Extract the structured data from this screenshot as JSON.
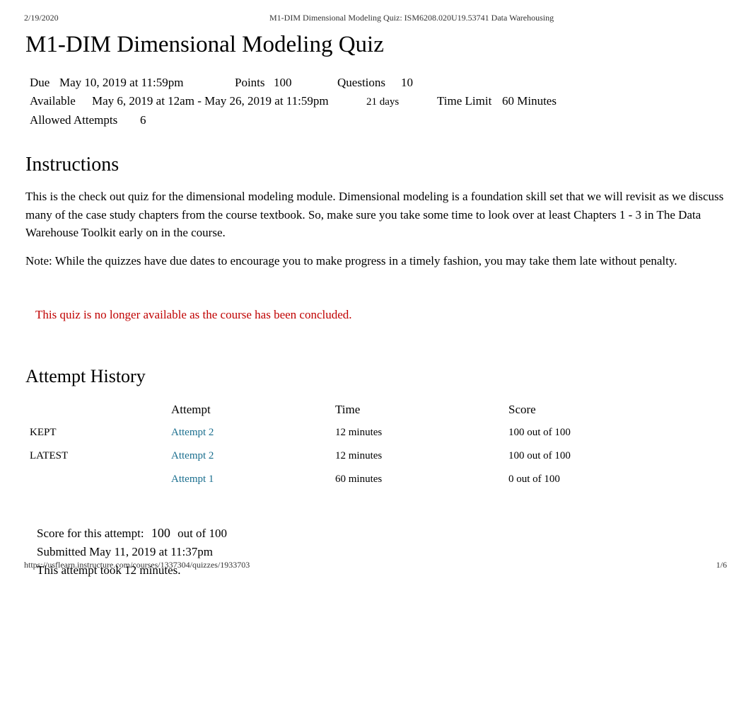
{
  "header": {
    "print_date": "2/19/2020",
    "doc_title": "M1-DIM Dimensional Modeling Quiz: ISM6208.020U19.53741 Data Warehousing"
  },
  "title": "M1-DIM Dimensional Modeling Quiz",
  "meta": {
    "due_label": "Due",
    "due_value": "May 10, 2019 at 11:59pm",
    "points_label": "Points",
    "points_value": "100",
    "questions_label": "Questions",
    "questions_value": "10",
    "available_label": "Available",
    "available_value": "May 6, 2019 at 12am - May 26, 2019 at 11:59pm",
    "available_days": "21 days",
    "timelimit_label": "Time Limit",
    "timelimit_value": "60 Minutes",
    "allowed_label": "Allowed Attempts",
    "allowed_value": "6"
  },
  "instructions_heading": "Instructions",
  "instructions": {
    "p1": "This is the check out quiz for the dimensional modeling module.           Dimensional modeling is a foundation skill set that we will revisit as we discuss many of the case study chapters from the course textbook.                  So, make sure you take some time to look over at least Chapters 1 - 3 in The Data Warehouse Toolkit       early on in the course.",
    "p2": "Note: While the quizzes have due dates to encourage you to make progress in a timely fashion, you may take them late without penalty."
  },
  "notice": "This quiz is no longer available as the course has been concluded.",
  "attempt_history_heading": "Attempt History",
  "history": {
    "cols": {
      "attempt": "Attempt",
      "time": "Time",
      "score": "Score"
    },
    "rows": [
      {
        "tag": "KEPT",
        "attempt": "Attempt 2",
        "time": "12 minutes",
        "score": "100 out of 100"
      },
      {
        "tag": "LATEST",
        "attempt": "Attempt 2",
        "time": "12 minutes",
        "score": "100 out of 100"
      },
      {
        "tag": "",
        "attempt": "Attempt 1",
        "time": "60 minutes",
        "score": "0 out of 100"
      }
    ]
  },
  "score_section": {
    "label": "Score for this attempt:",
    "score": "100",
    "outof": "out of 100",
    "submitted": "Submitted May 11, 2019 at 11:37pm",
    "took": "This attempt took 12 minutes."
  },
  "footer": {
    "url": "https://usflearn.instructure.com/courses/1337304/quizzes/1933703",
    "page": "1/6"
  }
}
